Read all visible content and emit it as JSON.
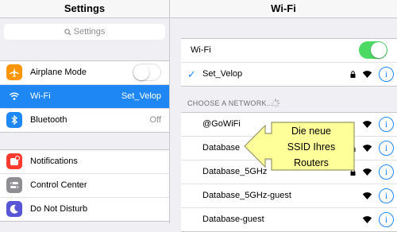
{
  "left_panel": {
    "title": "Settings",
    "search": {
      "placeholder": "Settings"
    },
    "group1": [
      {
        "label": "Airplane Mode",
        "icon": "airplane-icon",
        "icon_color": "#ff9500",
        "toggle": false
      },
      {
        "label": "Wi-Fi",
        "icon": "wifi-icon",
        "icon_color": "#1f87f4",
        "value": "Set_Velop",
        "selected": true
      },
      {
        "label": "Bluetooth",
        "icon": "bluetooth-icon",
        "icon_color": "#1f87f4",
        "value": "Off"
      }
    ],
    "group2": [
      {
        "label": "Notifications",
        "icon": "notifications-icon",
        "icon_color": "#ff3b30"
      },
      {
        "label": "Control Center",
        "icon": "control-center-icon",
        "icon_color": "#8e8e93"
      },
      {
        "label": "Do Not Disturb",
        "icon": "moon-icon",
        "icon_color": "#5856d6"
      }
    ]
  },
  "right_panel": {
    "title": "Wi-Fi",
    "wifi_toggle_label": "Wi-Fi",
    "wifi_toggle": true,
    "connected_network": "Set_Velop",
    "section_header": "CHOOSE A NETWORK...",
    "networks": [
      {
        "name": "@GoWiFi",
        "locked": false
      },
      {
        "name": "Database",
        "locked": true
      },
      {
        "name": "Database_5GHz",
        "locked": true
      },
      {
        "name": "Database_5GHz-guest",
        "locked": false
      },
      {
        "name": "Database-guest",
        "locked": false
      }
    ],
    "info_glyph": "i",
    "check_glyph": "✓"
  },
  "callout": {
    "line1": "Die neue",
    "line2": "SSID Ihres",
    "line3": "Routers",
    "color": "#ffff99"
  },
  "colors": {
    "accent": "#1f87f4",
    "toggle_on": "#4cd964"
  }
}
